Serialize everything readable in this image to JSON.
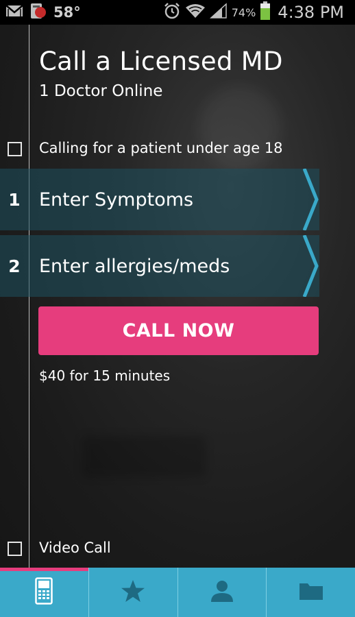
{
  "status_bar": {
    "temperature": "58°",
    "battery_percent": "74%",
    "time": "4:38 PM",
    "icons": [
      "gmail-icon",
      "weather-app-icon",
      "alarm-icon",
      "wifi-icon",
      "signal-icon",
      "battery-icon"
    ]
  },
  "header": {
    "title": "Call a Licensed MD",
    "subtitle": "1 Doctor Online"
  },
  "options": {
    "under_18_label": "Calling for a patient under age 18",
    "under_18_checked": false,
    "video_call_label": "Video Call",
    "video_call_checked": false
  },
  "steps": [
    {
      "number": "1",
      "label": "Enter Symptoms"
    },
    {
      "number": "2",
      "label": "Enter allergies/meds"
    }
  ],
  "call_button": {
    "label": "CALL NOW",
    "color": "#e63d7d"
  },
  "price_text": "$40 for 15 minutes",
  "tabs": [
    {
      "icon": "phone-icon",
      "active": true
    },
    {
      "icon": "star-icon",
      "active": false
    },
    {
      "icon": "person-icon",
      "active": false
    },
    {
      "icon": "folder-icon",
      "active": false
    }
  ],
  "colors": {
    "accent": "#e63d7d",
    "tabbar": "#3aa9c9",
    "step_bg": "#1e505e"
  }
}
